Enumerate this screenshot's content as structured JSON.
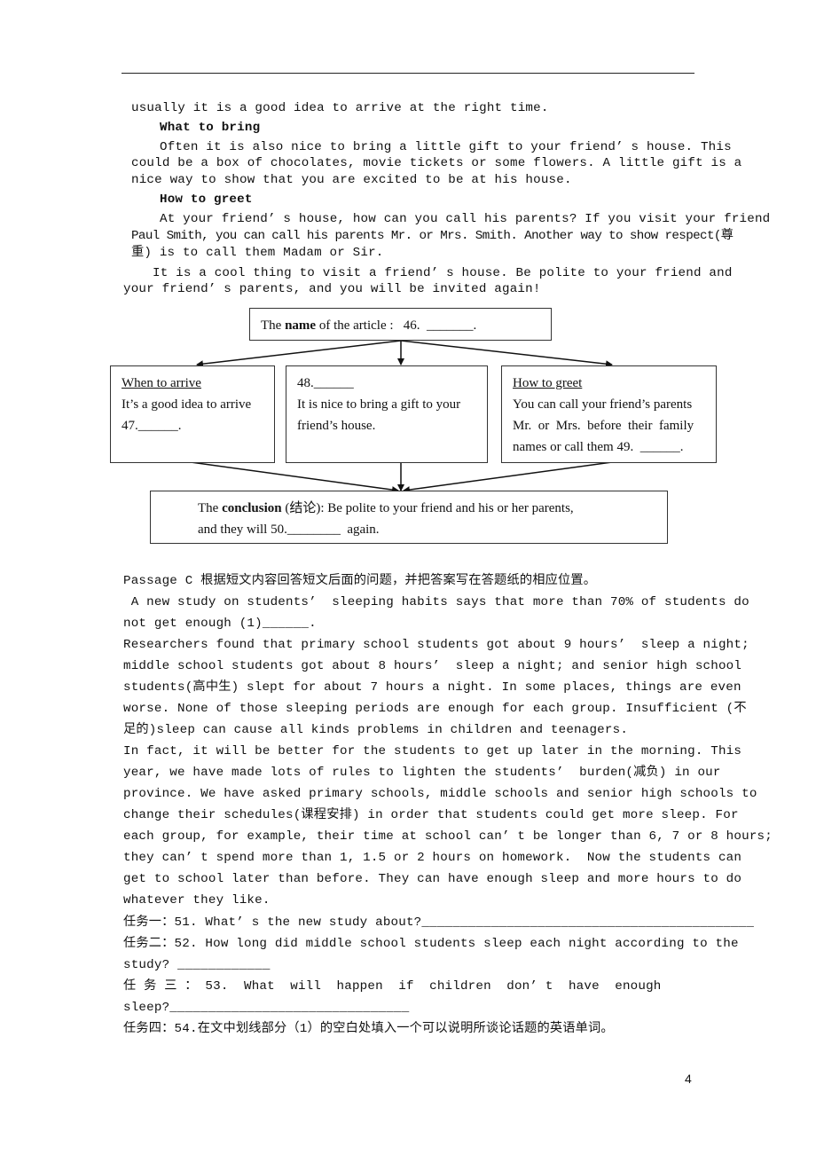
{
  "passage_b_tail": {
    "line1": "usually it is a good idea to arrive at the right time.",
    "heading_bring": "What to bring",
    "bring_lines": [
      "Often it is also nice to bring a little gift to your friend’ s house. This",
      "could be a box of chocolates, movie tickets or some flowers. A little gift is a",
      "nice way to show that you are excited to be at his house."
    ],
    "heading_greet": "How to greet",
    "greet_lines": [
      "At your friend’ s house, how can you call his parents? If you visit your friend",
      "Paul Smith, you can call his parents Mr. or Mrs. Smith. Another way to show respect(尊",
      "重) is to call them Madam or Sir."
    ],
    "closing_lines": [
      "It is a cool thing to visit a friend’ s house. Be polite to your friend and",
      "your friend’ s parents, and you will be invited again!"
    ]
  },
  "diagram": {
    "top": {
      "prefix": "The ",
      "bold": "name",
      "suffix": " of the article :   46.  _______."
    },
    "left": {
      "title": "When to arrive",
      "lines": [
        "It’s a good idea to arrive",
        "47.______."
      ]
    },
    "middle": {
      "title": "48.______",
      "lines": [
        "It is nice to bring a gift to your",
        "friend’s house."
      ]
    },
    "right": {
      "title": "How to greet",
      "lines": [
        "You can call your friend’s parents",
        "Mr.  or  Mrs.  before  their  family",
        "names or call them 49.  ______."
      ]
    },
    "bottom": {
      "prefix": "The ",
      "bold": "conclusion",
      "suffix": " (结论): Be polite to your friend and his or her parents,",
      "line2": "and they will 50.________  again."
    }
  },
  "passage_c": {
    "instruction": "Passage C 根据短文内容回答短文后面的问题，并把答案写在答题纸的相应位置。",
    "lines": [
      " A new study on students’  sleeping habits says that more than 70% of students do",
      "not get enough (1)______.",
      "Researchers found that primary school students got about 9 hours’  sleep a night;",
      "middle school students got about 8 hours’  sleep a night; and senior high school",
      "students(高中生) slept for about 7 hours a night. In some places, things are even",
      "worse. None of those sleeping periods are enough for each group. Insufficient (不",
      "足的)sleep can cause all kinds problems in children and teenagers.",
      "In fact, it will be better for the students to get up later in the morning. This",
      "year, we have made lots of rules to lighten the students’  burden(减负) in our",
      "province. We have asked primary schools, middle schools and senior high schools to",
      "change their schedules(课程安排) in order that students could get more sleep. For",
      "each group, for example, their time at school can’ t be longer than 6, 7 or 8 hours;",
      "they can’ t spend more than 1, 1.5 or 2 hours on homework.  Now the students can",
      "get to school later than before. They can have enough sleep and more hours to do",
      "whatever they like."
    ],
    "tasks": [
      "任务一：51. What’ s the new study about?___________________________________________",
      "任务二：52. How long did middle school students sleep each night according to the",
      "study? ____________",
      "任 务 三 ： 53.  What  will  happen  if  children  don’ t  have  enough",
      "sleep?_______________________________",
      "任务四：54.在文中划线部分（1）的空白处填入一个可以说明所谈论话题的英语单词。"
    ]
  },
  "footer": {
    "page_number": "4"
  }
}
